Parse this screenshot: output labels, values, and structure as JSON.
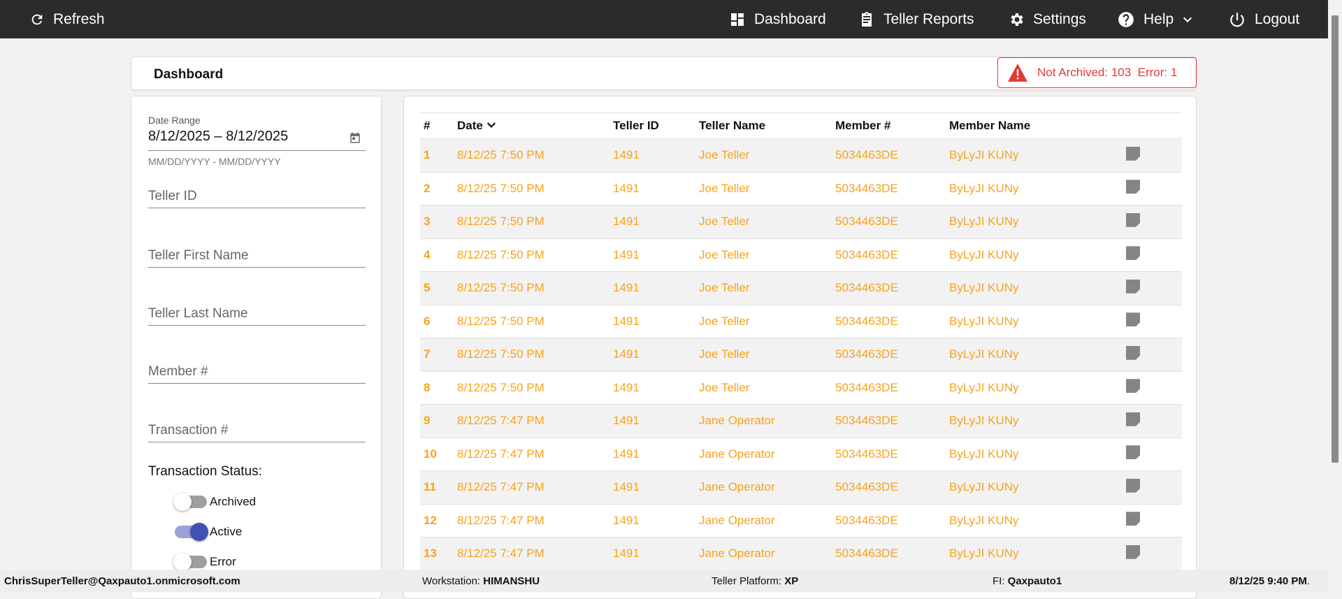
{
  "topbar": {
    "refresh": "Refresh",
    "dashboard": "Dashboard",
    "teller_reports": "Teller Reports",
    "settings": "Settings",
    "help": "Help",
    "logout": "Logout"
  },
  "header": {
    "title": "Dashboard",
    "alert": "Not Archived: 103  Error: 1"
  },
  "filters": {
    "date_range_label": "Date Range",
    "date_range_value": "8/12/2025 – 8/12/2025",
    "date_hint": "MM/DD/YYYY - MM/DD/YYYY",
    "teller_id": "Teller ID",
    "teller_first": "Teller First Name",
    "teller_last": "Teller Last Name",
    "member": "Member #",
    "transaction": "Transaction #",
    "status_title": "Transaction Status:",
    "toggles": [
      {
        "label": "Archived",
        "on": false
      },
      {
        "label": "Active",
        "on": true
      },
      {
        "label": "Error",
        "on": false
      }
    ]
  },
  "table": {
    "columns": [
      "#",
      "Date",
      "Teller ID",
      "Teller Name",
      "Member #",
      "Member Name"
    ],
    "rows": [
      [
        "1",
        "8/12/25 7:50 PM",
        "1491",
        "Joe Teller",
        "5034463DE",
        "ByLyJI KUNy"
      ],
      [
        "2",
        "8/12/25 7:50 PM",
        "1491",
        "Joe Teller",
        "5034463DE",
        "ByLyJI KUNy"
      ],
      [
        "3",
        "8/12/25 7:50 PM",
        "1491",
        "Joe Teller",
        "5034463DE",
        "ByLyJI KUNy"
      ],
      [
        "4",
        "8/12/25 7:50 PM",
        "1491",
        "Joe Teller",
        "5034463DE",
        "ByLyJI KUNy"
      ],
      [
        "5",
        "8/12/25 7:50 PM",
        "1491",
        "Joe Teller",
        "5034463DE",
        "ByLyJI KUNy"
      ],
      [
        "6",
        "8/12/25 7:50 PM",
        "1491",
        "Joe Teller",
        "5034463DE",
        "ByLyJI KUNy"
      ],
      [
        "7",
        "8/12/25 7:50 PM",
        "1491",
        "Joe Teller",
        "5034463DE",
        "ByLyJI KUNy"
      ],
      [
        "8",
        "8/12/25 7:50 PM",
        "1491",
        "Joe Teller",
        "5034463DE",
        "ByLyJI KUNy"
      ],
      [
        "9",
        "8/12/25 7:47 PM",
        "1491",
        "Jane Operator",
        "5034463DE",
        "ByLyJI KUNy"
      ],
      [
        "10",
        "8/12/25 7:47 PM",
        "1491",
        "Jane Operator",
        "5034463DE",
        "ByLyJI KUNy"
      ],
      [
        "11",
        "8/12/25 7:47 PM",
        "1491",
        "Jane Operator",
        "5034463DE",
        "ByLyJI KUNy"
      ],
      [
        "12",
        "8/12/25 7:47 PM",
        "1491",
        "Jane Operator",
        "5034463DE",
        "ByLyJI KUNy"
      ],
      [
        "13",
        "8/12/25 7:47 PM",
        "1491",
        "Jane Operator",
        "5034463DE",
        "ByLyJI KUNy"
      ]
    ]
  },
  "footer": {
    "user": "ChrisSuperTeller@Qaxpauto1.onmicrosoft.com",
    "workstation_label": "Workstation: ",
    "workstation": "HIMANSHU",
    "platform_label": "Teller Platform: ",
    "platform": "XP",
    "fi_label": "FI: ",
    "fi": "Qaxpauto1",
    "datetime": "8/12/25 9:40 PM",
    "datetime_suffix": "."
  },
  "colors": {
    "accent": "#f9a21b",
    "alert": "#e53935",
    "toggle_on": "#3f51b5",
    "topbar": "#2b2b2b"
  }
}
